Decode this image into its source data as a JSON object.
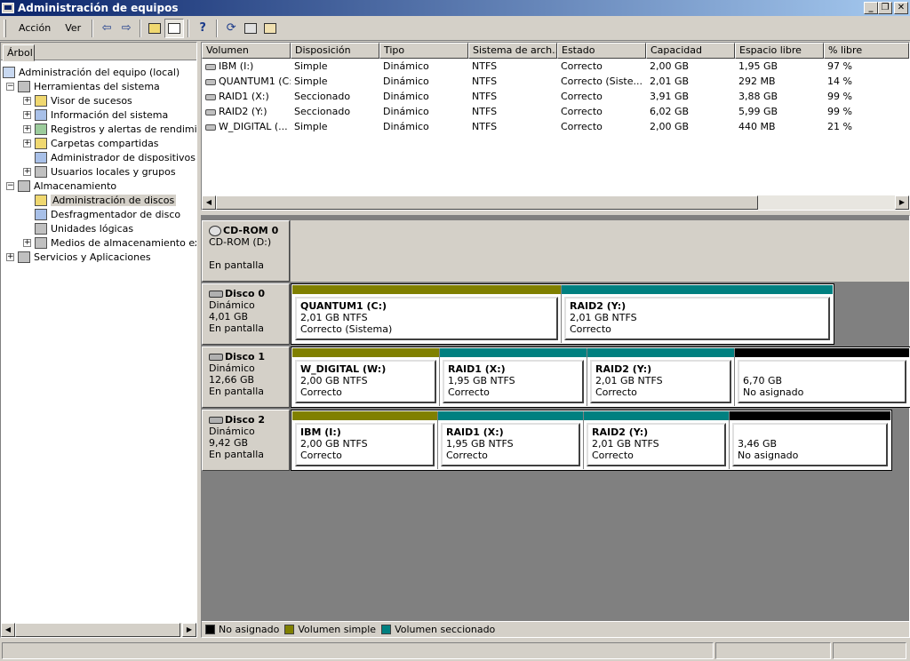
{
  "window": {
    "title": "Administración de equipos"
  },
  "menu": {
    "items": [
      "Acción",
      "Ver"
    ]
  },
  "tree": {
    "tab_label": "Árbol",
    "nodes": [
      {
        "label": "Administración del equipo (local)"
      },
      {
        "label": "Herramientas del sistema"
      },
      {
        "label": "Visor de sucesos"
      },
      {
        "label": "Información del sistema"
      },
      {
        "label": "Registros y alertas de rendimiento"
      },
      {
        "label": "Carpetas compartidas"
      },
      {
        "label": "Administrador de dispositivos"
      },
      {
        "label": "Usuarios locales y grupos"
      },
      {
        "label": "Almacenamiento"
      },
      {
        "label": "Administración de discos"
      },
      {
        "label": "Desfragmentador de disco"
      },
      {
        "label": "Unidades lógicas"
      },
      {
        "label": "Medios de almacenamiento extraíbles"
      },
      {
        "label": "Servicios y Aplicaciones"
      }
    ]
  },
  "volumes": {
    "columns": [
      "Volumen",
      "Disposición",
      "Tipo",
      "Sistema de arch...",
      "Estado",
      "Capacidad",
      "Espacio libre",
      "% libre"
    ],
    "rows": [
      [
        "IBM (I:)",
        "Simple",
        "Dinámico",
        "NTFS",
        "Correcto",
        "2,00 GB",
        "1,95 GB",
        "97 %"
      ],
      [
        "QUANTUM1 (C:)",
        "Simple",
        "Dinámico",
        "NTFS",
        "Correcto (Siste...",
        "2,01 GB",
        "292 MB",
        "14 %"
      ],
      [
        "RAID1 (X:)",
        "Seccionado",
        "Dinámico",
        "NTFS",
        "Correcto",
        "3,91 GB",
        "3,88 GB",
        "99 %"
      ],
      [
        "RAID2 (Y:)",
        "Seccionado",
        "Dinámico",
        "NTFS",
        "Correcto",
        "6,02 GB",
        "5,99 GB",
        "99 %"
      ],
      [
        "W_DIGITAL (...",
        "Simple",
        "Dinámico",
        "NTFS",
        "Correcto",
        "2,00 GB",
        "440 MB",
        "21 %"
      ]
    ]
  },
  "disks": [
    {
      "name": "CD-ROM 0",
      "l1": "CD-ROM (D:)",
      "l2": "",
      "l3": "En pantalla"
    },
    {
      "name": "Disco 0",
      "l1": "Dinámico",
      "l2": "4,01 GB",
      "l3": "En pantalla",
      "partitions": [
        {
          "name": "QUANTUM1  (C:)",
          "size": "2,01 GB NTFS",
          "status": "Correcto (Sistema)",
          "color": "#808000"
        },
        {
          "name": "RAID2  (Y:)",
          "size": "2,01 GB NTFS",
          "status": "Correcto",
          "color": "#008080"
        }
      ]
    },
    {
      "name": "Disco 1",
      "l1": "Dinámico",
      "l2": "12,66 GB",
      "l3": "En pantalla",
      "partitions": [
        {
          "name": "W_DIGITAL  (W:)",
          "size": "2,00 GB NTFS",
          "status": "Correcto",
          "color": "#808000"
        },
        {
          "name": "RAID1  (X:)",
          "size": "1,95 GB NTFS",
          "status": "Correcto",
          "color": "#008080"
        },
        {
          "name": "RAID2  (Y:)",
          "size": "2,01 GB NTFS",
          "status": "Correcto",
          "color": "#008080"
        },
        {
          "name": "",
          "size": "6,70 GB",
          "status": "No asignado",
          "color": "#000000"
        }
      ]
    },
    {
      "name": "Disco 2",
      "l1": "Dinámico",
      "l2": "9,42 GB",
      "l3": "En pantalla",
      "partitions": [
        {
          "name": "IBM  (I:)",
          "size": "2,00 GB NTFS",
          "status": "Correcto",
          "color": "#808000"
        },
        {
          "name": "RAID1  (X:)",
          "size": "1,95 GB NTFS",
          "status": "Correcto",
          "color": "#008080"
        },
        {
          "name": "RAID2  (Y:)",
          "size": "2,01 GB NTFS",
          "status": "Correcto",
          "color": "#008080"
        },
        {
          "name": "",
          "size": "3,46 GB",
          "status": "No asignado",
          "color": "#000000"
        }
      ]
    }
  ],
  "legend": [
    {
      "label": "No asignado",
      "color": "#000000"
    },
    {
      "label": "Volumen simple",
      "color": "#808000"
    },
    {
      "label": "Volumen seccionado",
      "color": "#008080"
    }
  ]
}
